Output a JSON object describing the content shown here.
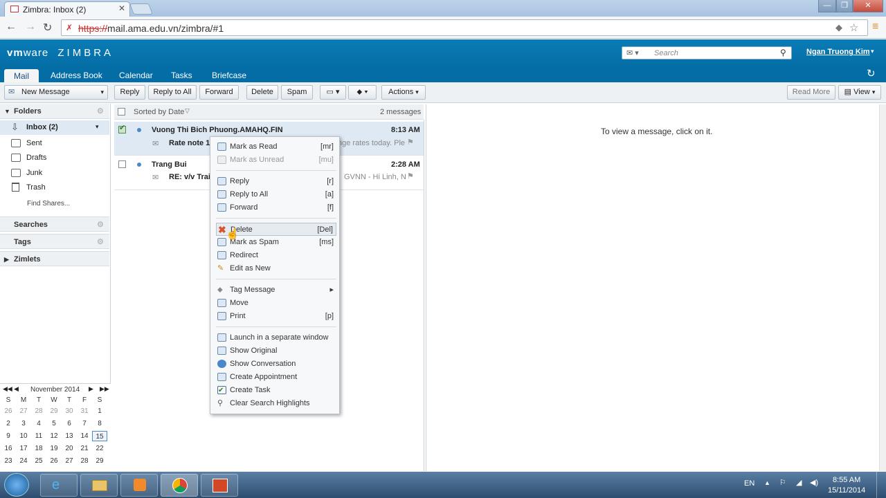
{
  "browser": {
    "tab_title": "Zimbra: Inbox (2)",
    "url_scheme": "https://",
    "url_rest": "mail.ama.edu.vn/zimbra/#1"
  },
  "header": {
    "logo_vm": "vm",
    "logo_ware": "ware",
    "logo_zimbra": "ZIMBRA",
    "search_placeholder": "Search",
    "user_name": "Ngan Truong Kim"
  },
  "app_tabs": [
    "Mail",
    "Address Book",
    "Calendar",
    "Tasks",
    "Briefcase"
  ],
  "toolbar": {
    "new_message": "New Message",
    "reply": "Reply",
    "reply_all": "Reply to All",
    "forward": "Forward",
    "delete": "Delete",
    "spam": "Spam",
    "actions": "Actions",
    "read_more": "Read More",
    "view": "View"
  },
  "sidebar": {
    "folders_label": "Folders",
    "folders": [
      {
        "label": "Inbox (2)",
        "icon": "inbox-icon"
      },
      {
        "label": "Sent",
        "icon": "sent-icon"
      },
      {
        "label": "Drafts",
        "icon": "drafts-icon"
      },
      {
        "label": "Junk",
        "icon": "junk-icon"
      },
      {
        "label": "Trash",
        "icon": "trash-icon"
      }
    ],
    "find_shares": "Find Shares...",
    "searches": "Searches",
    "tags": "Tags",
    "zimlets": "Zimlets"
  },
  "calendar": {
    "month": "November 2014",
    "weekdays": [
      "S",
      "M",
      "T",
      "W",
      "T",
      "F",
      "S"
    ],
    "weeks": [
      [
        "26",
        "27",
        "28",
        "29",
        "30",
        "31",
        "1"
      ],
      [
        "2",
        "3",
        "4",
        "5",
        "6",
        "7",
        "8"
      ],
      [
        "9",
        "10",
        "11",
        "12",
        "13",
        "14",
        "15"
      ],
      [
        "16",
        "17",
        "18",
        "19",
        "20",
        "21",
        "22"
      ],
      [
        "23",
        "24",
        "25",
        "26",
        "27",
        "28",
        "29"
      ]
    ],
    "today": "15"
  },
  "list": {
    "sort_label": "Sorted by Date",
    "count": "2 messages",
    "messages": [
      {
        "sender": "Vuong Thi Bich Phuong.AMAHQ.FIN",
        "subject": "Rate note 15",
        "fragment": "nge rates today. Ple",
        "time": "8:13 AM"
      },
      {
        "sender": "Trang Bui",
        "subject": "RE: v/v Trai",
        "fragment": "GVNN - Hi Linh, N",
        "time": "2:28 AM"
      }
    ]
  },
  "reading_pane": {
    "message": "To view a message, click on it."
  },
  "context_menu": {
    "groups": [
      [
        {
          "label": "Mark as Read",
          "shortcut": "[mr]",
          "icon": "mark-read-icon"
        },
        {
          "label": "Mark as Unread",
          "shortcut": "[mu]",
          "icon": "mark-unread-icon",
          "disabled": true
        }
      ],
      [
        {
          "label": "Reply",
          "shortcut": "[r]",
          "icon": "reply-icon"
        },
        {
          "label": "Reply to All",
          "shortcut": "[a]",
          "icon": "reply-all-icon"
        },
        {
          "label": "Forward",
          "shortcut": "[f]",
          "icon": "forward-icon"
        }
      ],
      [
        {
          "label": "Delete",
          "shortcut": "[Del]",
          "icon": "delete-icon",
          "highlighted": true
        },
        {
          "label": "Mark as Spam",
          "shortcut": "[ms]",
          "icon": "spam-icon"
        },
        {
          "label": "Redirect",
          "shortcut": "",
          "icon": "redirect-icon"
        },
        {
          "label": "Edit as New",
          "shortcut": "",
          "icon": "edit-icon"
        }
      ],
      [
        {
          "label": "Tag Message",
          "shortcut": "▸",
          "icon": "tag-icon"
        },
        {
          "label": "Move",
          "shortcut": "",
          "icon": "move-icon"
        },
        {
          "label": "Print",
          "shortcut": "[p]",
          "icon": "print-icon"
        }
      ],
      [
        {
          "label": "Launch in a separate window",
          "shortcut": "",
          "icon": "launch-window-icon"
        },
        {
          "label": "Show Original",
          "shortcut": "",
          "icon": "show-original-icon"
        },
        {
          "label": "Show Conversation",
          "shortcut": "",
          "icon": "conversation-icon"
        },
        {
          "label": "Create Appointment",
          "shortcut": "",
          "icon": "appointment-icon"
        },
        {
          "label": "Create Task",
          "shortcut": "",
          "icon": "task-icon"
        },
        {
          "label": "Clear Search Highlights",
          "shortcut": "",
          "icon": "clear-search-icon"
        }
      ]
    ]
  },
  "taskbar": {
    "lang": "EN",
    "time": "8:55 AM",
    "date": "15/11/2014"
  },
  "colors": {
    "header_blue": "#046da5",
    "menu_highlight": "#e6ebf1",
    "delete_red": "#d9532c"
  }
}
